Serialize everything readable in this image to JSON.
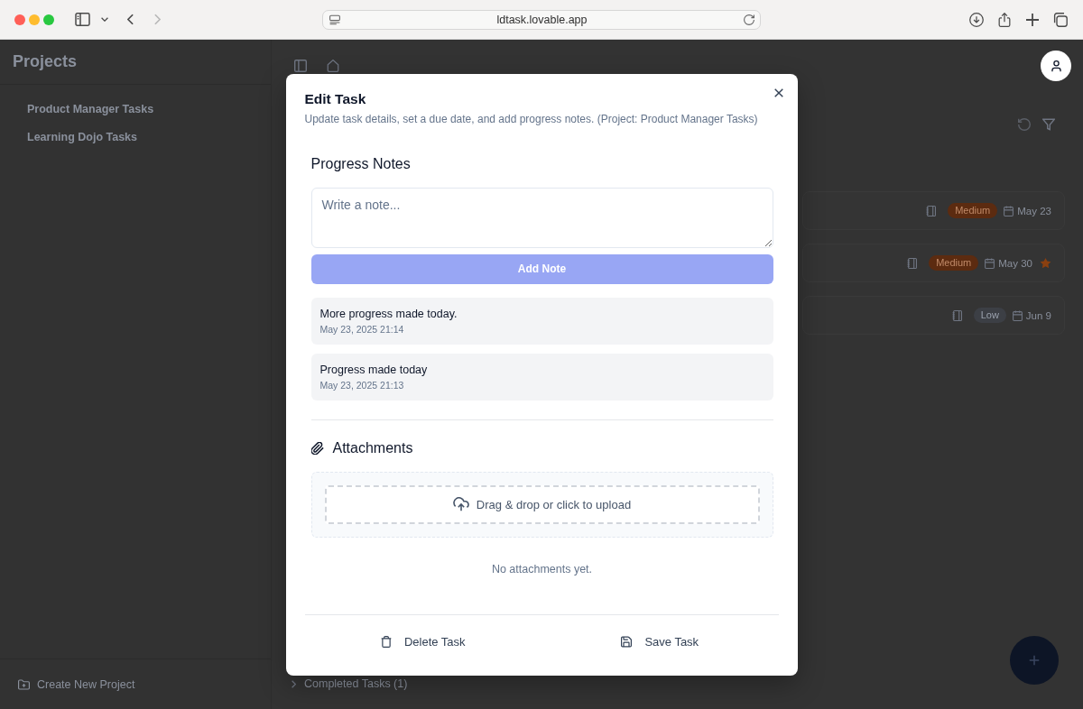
{
  "browser": {
    "url": "ldtask.lovable.app",
    "back": {
      "disabled": false
    },
    "forward": {
      "disabled": true
    }
  },
  "sidebar": {
    "title": "Projects",
    "projects": [
      {
        "name": "Product Manager Tasks"
      },
      {
        "name": "Learning Dojo Tasks"
      }
    ],
    "create_button": "Create New Project"
  },
  "tasks": [
    {
      "badge": {
        "label": "Medium",
        "kind": "medium"
      },
      "due": "May 23",
      "starred": false
    },
    {
      "badge": {
        "label": "Medium",
        "kind": "medium"
      },
      "due": "May 30",
      "starred": true
    },
    {
      "badge": {
        "label": "Low",
        "kind": "low"
      },
      "due": "Jun 9",
      "starred": false
    }
  ],
  "completed_section": {
    "label": "Completed Tasks (1)",
    "expanded": false
  },
  "dialog": {
    "title": "Edit Task",
    "subtitle": "Update task details, set a due date, and add progress notes. (Project: Product Manager Tasks)",
    "notes_heading": "Progress Notes",
    "note_input": {
      "placeholder": "Write a note..."
    },
    "add_button": {
      "label": "Add Note",
      "disabled": true
    },
    "notes": [
      {
        "text": "More progress made today.",
        "timestamp": "May 23, 2025 21:14"
      },
      {
        "text": "Progress made today",
        "timestamp": "May 23, 2025 21:13"
      }
    ],
    "attachments_heading": "Attachments",
    "dropzone": "Drag & drop or click to upload",
    "empty_text": "No attachments yet.",
    "actions": [
      {
        "label": "Delete Task",
        "kind": "delete"
      },
      {
        "label": "Save Task",
        "kind": "save"
      }
    ]
  }
}
